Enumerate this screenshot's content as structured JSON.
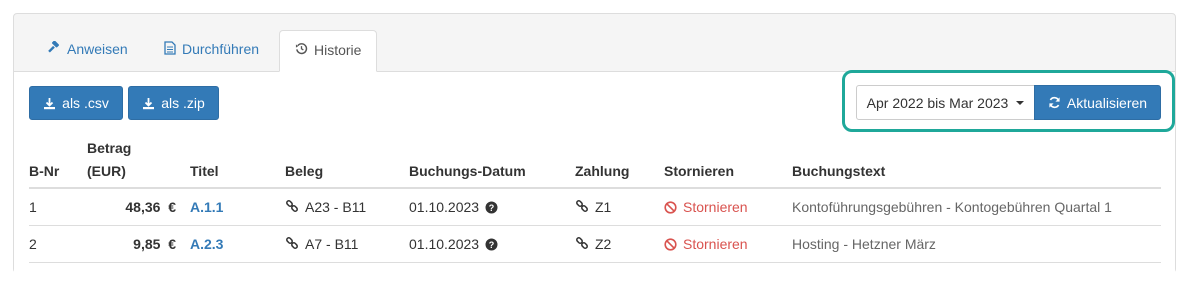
{
  "tabs": [
    {
      "label": "Anweisen",
      "icon": "gavel-icon"
    },
    {
      "label": "Durchführen",
      "icon": "file-icon"
    },
    {
      "label": "Historie",
      "icon": "history-icon"
    }
  ],
  "toolbar": {
    "csv_label": "als .csv",
    "zip_label": "als .zip",
    "period_label": "Apr 2022 bis Mar 2023",
    "refresh_label": "Aktualisieren"
  },
  "table": {
    "headers": {
      "nr": "B-Nr",
      "betrag_line1": "Betrag",
      "betrag_line2": "(EUR)",
      "titel": "Titel",
      "beleg": "Beleg",
      "datum": "Buchungs-Datum",
      "zahlung": "Zahlung",
      "storno": "Stornieren",
      "text": "Buchungstext"
    },
    "rows": [
      {
        "nr": "1",
        "betrag": "48,36",
        "currency": "€",
        "titel": "A.1.1",
        "beleg": "A23 - B11",
        "datum": "01.10.2023",
        "zahlung": "Z1",
        "storno": "Stornieren",
        "text": "Kontoführungsgebühren - Kontogebühren Quartal 1"
      },
      {
        "nr": "2",
        "betrag": "9,85",
        "currency": "€",
        "titel": "A.2.3",
        "beleg": "A7 - B11",
        "datum": "01.10.2023",
        "zahlung": "Z2",
        "storno": "Stornieren",
        "text": "Hosting - Hetzner März"
      }
    ]
  },
  "colors": {
    "primary": "#337ab7",
    "danger": "#d9534f",
    "highlight": "#1fa89a"
  }
}
